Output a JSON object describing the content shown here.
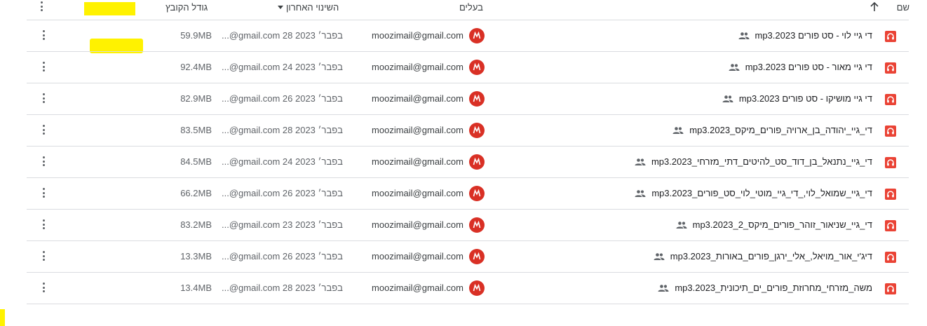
{
  "header": {
    "name_label": "שם",
    "owner_label": "בעלים",
    "modified_label": "השינוי האחרון",
    "size_label": "גודל הקובץ"
  },
  "rows": [
    {
      "name": "די גיי לוי - סט פורים mp3.2023",
      "owner": "moozimail@gmail.com",
      "modified_date": "28 בפבר׳ 2023",
      "modified_by": "...@gmail.com",
      "size": "59.9MB"
    },
    {
      "name": "די גיי מאור - סט פורים mp3.2023",
      "owner": "moozimail@gmail.com",
      "modified_date": "24 בפבר׳ 2023",
      "modified_by": "...@gmail.com",
      "size": "92.4MB"
    },
    {
      "name": "די גיי מושיקו - סט פורים mp3.2023",
      "owner": "moozimail@gmail.com",
      "modified_date": "26 בפבר׳ 2023",
      "modified_by": "...@gmail.com",
      "size": "82.9MB"
    },
    {
      "name": "די_גיי_יהודה_בן_ארויה_פורים_מיקס_mp3.2023",
      "owner": "moozimail@gmail.com",
      "modified_date": "28 בפבר׳ 2023",
      "modified_by": "...@gmail.com",
      "size": "83.5MB"
    },
    {
      "name": "די_גיי_נתנאל_בן_דוד_סט_להיטים_דתי_מזרחי_mp3.2023",
      "owner": "moozimail@gmail.com",
      "modified_date": "24 בפבר׳ 2023",
      "modified_by": "...@gmail.com",
      "size": "84.5MB"
    },
    {
      "name": "די_גיי_שמואל_לוי,_די_גיי_מוטי_לוי_סט_פורים_mp3.2023",
      "owner": "moozimail@gmail.com",
      "modified_date": "26 בפבר׳ 2023",
      "modified_by": "...@gmail.com",
      "size": "66.2MB"
    },
    {
      "name": "די_גיי_שניאור_זוהר_פורים_מיקס_2_mp3.2023",
      "owner": "moozimail@gmail.com",
      "modified_date": "23 בפבר׳ 2023",
      "modified_by": "...@gmail.com",
      "size": "83.2MB"
    },
    {
      "name": "דיג'י_אור_מויאל,_אלי_ירגן_פורים_באורות_mp3.2023",
      "owner": "moozimail@gmail.com",
      "modified_date": "26 בפבר׳ 2023",
      "modified_by": "...@gmail.com",
      "size": "13.3MB"
    },
    {
      "name": "משה_מזרחי_מחרוזת_פורים_ים_תיכונית_mp3.2023",
      "owner": "moozimail@gmail.com",
      "modified_date": "28 בפבר׳ 2023",
      "modified_by": "...@gmail.com",
      "size": "13.4MB"
    }
  ],
  "colors": {
    "accent_red": "#d93025",
    "highlight": "#fff200"
  }
}
